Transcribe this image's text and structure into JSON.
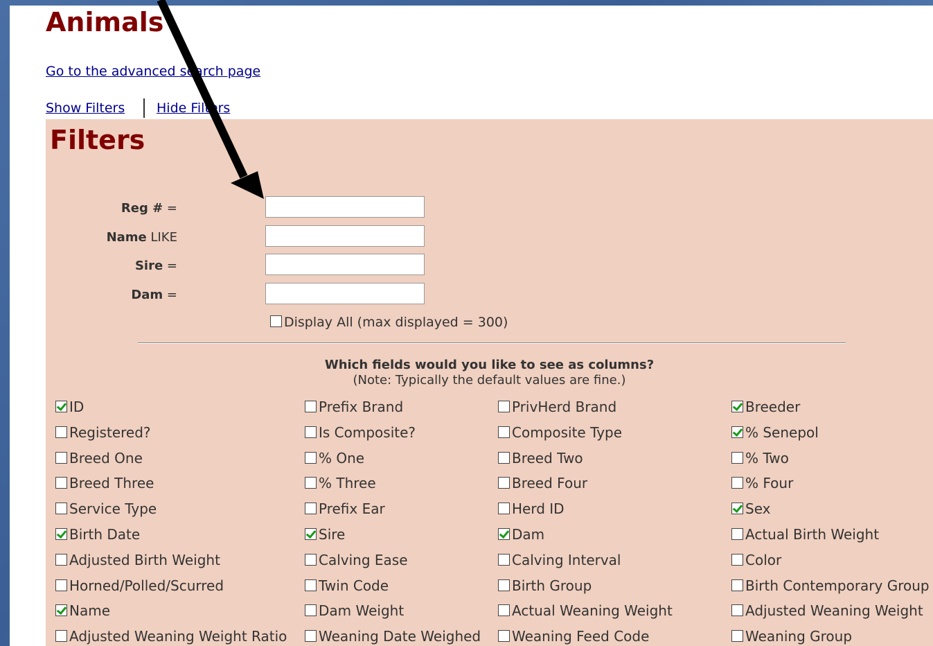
{
  "page": {
    "title": "Animals",
    "advanced_search_link": "Go to the advanced search page",
    "show_filters_link": "Show Filters",
    "hide_filters_link": "Hide Filters"
  },
  "filters": {
    "heading": "Filters",
    "fields": [
      {
        "bold": "Reg #",
        "op": " ="
      },
      {
        "bold": "Name",
        "op": " LIKE"
      },
      {
        "bold": "Sire",
        "op": " ="
      },
      {
        "bold": "Dam",
        "op": " ="
      }
    ],
    "display_all": {
      "label": "Display All (max displayed = 300)",
      "checked": false
    },
    "columns_question": "Which fields would you like to see as columns?",
    "columns_note": "(Note: Typically the default values are fine.)",
    "column_fields": [
      [
        {
          "label": "ID",
          "checked": true
        },
        {
          "label": "Registered?",
          "checked": false
        },
        {
          "label": "Breed One",
          "checked": false
        },
        {
          "label": "Breed Three",
          "checked": false
        },
        {
          "label": "Service Type",
          "checked": false
        },
        {
          "label": "Birth Date",
          "checked": true
        },
        {
          "label": "Adjusted Birth Weight",
          "checked": false
        },
        {
          "label": "Horned/Polled/Scurred",
          "checked": false
        },
        {
          "label": "Name",
          "checked": true
        },
        {
          "label": "Adjusted Weaning Weight Ratio",
          "checked": false
        }
      ],
      [
        {
          "label": "Prefix Brand",
          "checked": false
        },
        {
          "label": "Is Composite?",
          "checked": false
        },
        {
          "label": "% One",
          "checked": false
        },
        {
          "label": "% Three",
          "checked": false
        },
        {
          "label": "Prefix Ear",
          "checked": false
        },
        {
          "label": "Sire",
          "checked": true
        },
        {
          "label": "Calving Ease",
          "checked": false
        },
        {
          "label": "Twin Code",
          "checked": false
        },
        {
          "label": "Dam Weight",
          "checked": false
        },
        {
          "label": "Weaning Date Weighed",
          "checked": false
        }
      ],
      [
        {
          "label": "PrivHerd Brand",
          "checked": false
        },
        {
          "label": "Composite Type",
          "checked": false
        },
        {
          "label": "Breed Two",
          "checked": false
        },
        {
          "label": "Breed Four",
          "checked": false
        },
        {
          "label": "Herd ID",
          "checked": false
        },
        {
          "label": "Dam",
          "checked": true
        },
        {
          "label": "Calving Interval",
          "checked": false
        },
        {
          "label": "Birth Group",
          "checked": false
        },
        {
          "label": "Actual Weaning Weight",
          "checked": false
        },
        {
          "label": "Weaning Feed Code",
          "checked": false
        }
      ],
      [
        {
          "label": "Breeder",
          "checked": true
        },
        {
          "label": "% Senepol",
          "checked": true
        },
        {
          "label": "% Two",
          "checked": false
        },
        {
          "label": "% Four",
          "checked": false
        },
        {
          "label": "Sex",
          "checked": true
        },
        {
          "label": "Actual Birth Weight",
          "checked": false
        },
        {
          "label": "Color",
          "checked": false
        },
        {
          "label": "Birth Contemporary Group",
          "checked": false
        },
        {
          "label": "Adjusted Weaning Weight",
          "checked": false
        },
        {
          "label": "Weaning Group",
          "checked": false
        }
      ]
    ]
  },
  "annotation": {
    "icon": "arrow-icon",
    "color": "#000000"
  }
}
